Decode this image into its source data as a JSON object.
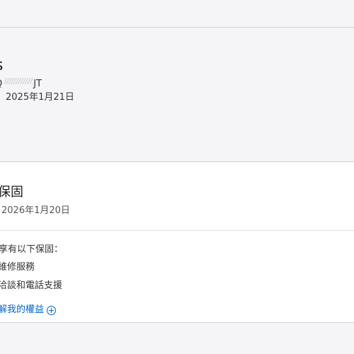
{
  "device": {
    "name": "s",
    "serial_prefix": "Q",
    "serial_suffix": "JT",
    "purchase_date": "2025年1月21日"
  },
  "coverage": {
    "title": "保固",
    "expiry": "2026年1月20日",
    "intro": "享有以下保固：",
    "benefits": [
      "維修服務",
      "洽談和電話支援"
    ],
    "learn_more": "解我的權益"
  },
  "colors": {
    "link": "#0066cc",
    "page_background": "#f5f5f7",
    "card_background": "#ffffff"
  },
  "icons": {
    "learn_more": "plus-circle-icon"
  }
}
